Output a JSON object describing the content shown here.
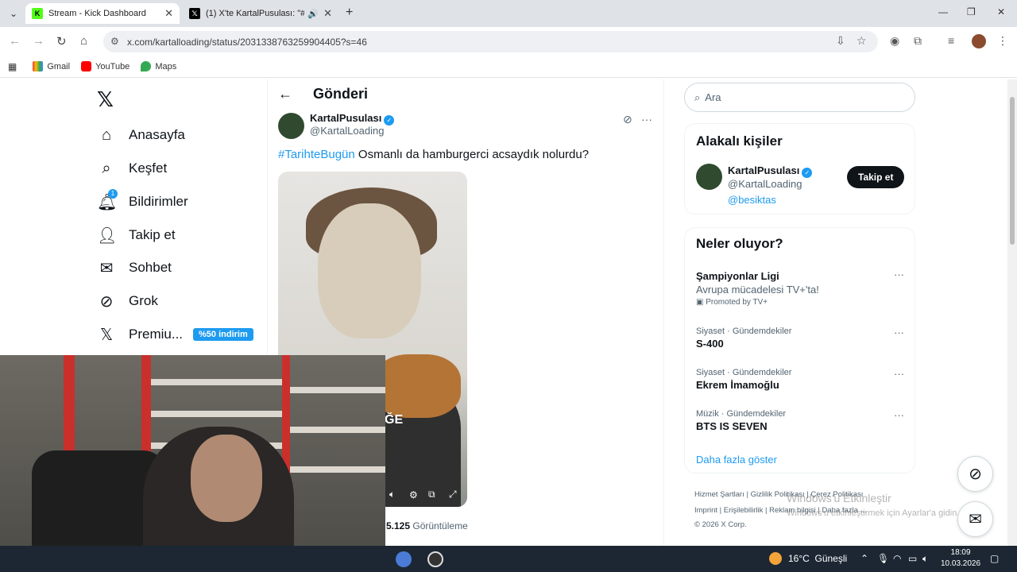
{
  "browser": {
    "tabs": [
      {
        "title": "Stream - Kick Dashboard",
        "icon": "kick-logo-icon"
      },
      {
        "title": "(1) X'te KartalPusulası: \"#Ta",
        "icon": "x-logo-icon"
      }
    ],
    "url": "x.com/kartalloading/status/2031338763259904405?s=46",
    "bookmarks": [
      {
        "label": "Gmail",
        "icon": "gmail-icon"
      },
      {
        "label": "YouTube",
        "icon": "youtube-icon"
      },
      {
        "label": "Maps",
        "icon": "maps-icon"
      }
    ]
  },
  "sidebar": {
    "items": [
      {
        "label": "Anasayfa",
        "icon": "home-icon"
      },
      {
        "label": "Keşfet",
        "icon": "search-icon"
      },
      {
        "label": "Bildirimler",
        "icon": "bell-icon",
        "badge": "1"
      },
      {
        "label": "Takip et",
        "icon": "person-add-icon"
      },
      {
        "label": "Sohbet",
        "icon": "mail-icon"
      },
      {
        "label": "Grok",
        "icon": "grok-icon"
      },
      {
        "label": "Premiu...",
        "icon": "x-logo-icon"
      }
    ],
    "premium_badge": "%50 indirim"
  },
  "post": {
    "header_title": "Gönderi",
    "author_name": "KartalPusulası",
    "author_handle": "@KartalLoading",
    "hashtag": "#TarihteBugün",
    "text": " Osmanlı da hamburgerci acsaydık nolurdu?",
    "media_caption": "ĞE",
    "views_count": "5.125",
    "views_label": "Görüntüleme"
  },
  "right": {
    "search_placeholder": "Ara",
    "related": {
      "title": "Alakalı kişiler",
      "name": "KartalPusulası",
      "handle": "@KartalLoading",
      "bio": "@besiktas",
      "follow_label": "Takip et"
    },
    "trends": {
      "title": "Neler oluyor?",
      "items": [
        {
          "meta": "",
          "name": "Şampiyonlar Ligi",
          "sub": "Avrupa mücadelesi TV+'ta!",
          "promo": "Promoted by TV+"
        },
        {
          "meta": "Siyaset · Gündemdekiler",
          "name": "S-400",
          "sub": "",
          "promo": ""
        },
        {
          "meta": "Siyaset · Gündemdekiler",
          "name": "Ekrem İmamoğlu",
          "sub": "",
          "promo": ""
        },
        {
          "meta": "Müzik · Gündemdekiler",
          "name": "BTS IS SEVEN",
          "sub": "",
          "promo": ""
        }
      ],
      "show_more": "Daha fazla göster"
    },
    "footer_line1": "Hizmet Şartları  |   Gizlilik Politikası   |   Çerez Politikası",
    "footer_line2": "Imprint   |   Erişilebilirlik   |   Reklam bilgisi   |   Daha fazla ...",
    "footer_line3": "© 2026 X Corp.",
    "watermark_title": "Windows'u Etkinleştir",
    "watermark_sub": "Windows'u etkinleştirmek için Ayarlar'a gidin."
  },
  "taskbar": {
    "temperature": "16°C",
    "weather": "Güneşli",
    "time": "18:09",
    "date": "10.03.2026"
  },
  "colors": {
    "accent": "#1d9bf0",
    "text": "#0f1419",
    "muted": "#536471",
    "taskbar": "#1c2733"
  }
}
